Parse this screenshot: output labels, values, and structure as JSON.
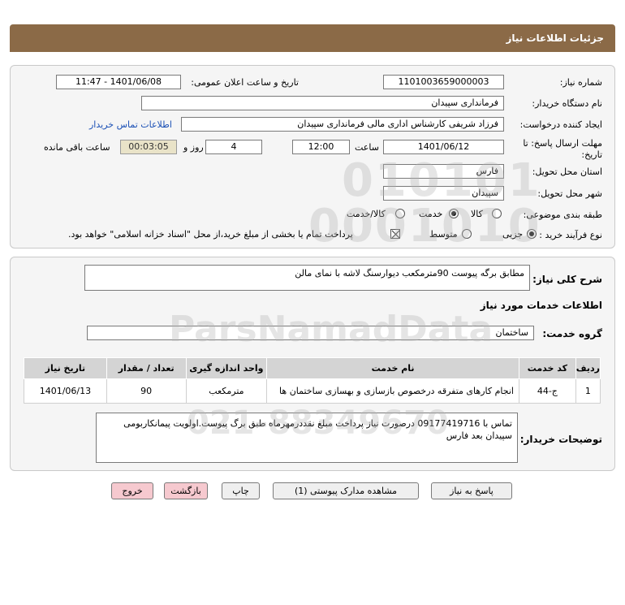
{
  "header": {
    "title": "جزئیات اطلاعات نیاز"
  },
  "form": {
    "need_number": {
      "label": "شماره نیاز:",
      "value": "1101003659000003"
    },
    "announce_datetime": {
      "label": "تاریخ و ساعت اعلان عمومی:",
      "value": "1401/06/08 - 11:47"
    },
    "buyer_org": {
      "label": "نام دستگاه خریدار:",
      "value": "فرمانداری سپیدان"
    },
    "creator": {
      "label": "ایجاد کننده درخواست:",
      "value": "فرزاد شریفی کارشناس اداری مالی فرمانداری سپیدان",
      "contact_link": "اطلاعات تماس خریدار"
    },
    "deadline": {
      "label_line1": "مهلت ارسال پاسخ: تا",
      "label_line2": "تاریخ:",
      "date": "1401/06/12",
      "time_label": "ساعت",
      "time": "12:00",
      "days": "4",
      "days_label": "روز و",
      "remaining": "00:03:05",
      "remaining_label": "ساعت باقی مانده"
    },
    "province": {
      "label": "استان محل تحویل:",
      "value": "فارس"
    },
    "city": {
      "label": "شهر محل تحویل:",
      "value": "سپیدان"
    },
    "category": {
      "label": "طبقه بندی موضوعی:",
      "options": [
        "کالا",
        "خدمت",
        "کالا/خدمت"
      ],
      "selected": "خدمت"
    },
    "purchase_type": {
      "label": "نوع فرآیند خرید :",
      "options": [
        "جزیی",
        "متوسط"
      ],
      "selected": "جزیی",
      "treasury_note": "پرداخت تمام یا بخشی از مبلغ خرید،از محل \"اسناد خزانه اسلامی\" خواهد بود."
    }
  },
  "description": {
    "label": "شرح کلی نیاز:",
    "value": "مطابق برگه پیوست 90مترمکعب دیوارسنگ لاشه با نمای مالن"
  },
  "services_info": {
    "title": "اطلاعات خدمات مورد نیاز"
  },
  "service_group": {
    "label": "گروه خدمت:",
    "value": "ساختمان"
  },
  "table": {
    "headers": [
      "ردیف",
      "کد خدمت",
      "نام خدمت",
      "واحد اندازه گیری",
      "تعداد / مقدار",
      "تاریخ نیاز"
    ],
    "rows": [
      [
        "1",
        "ج-44",
        "انجام کارهای متفرقه درخصوص بازسازی و بهسازی ساختمان ها",
        "مترمکعب",
        "90",
        "1401/06/13"
      ]
    ]
  },
  "buyer_notes": {
    "label": "توضیحات خریدار:",
    "value": "تماس با 09177419716 درصورت نیاز پرداخت مبلغ نقددرمهرماه طبق برگ پیوست.اولویت پیمانکاربومی سپیدان بعد فارس"
  },
  "buttons": {
    "reply": "پاسخ به نیاز",
    "view_attachments": "مشاهده مدارک پیوستی (1)",
    "print": "چاپ",
    "back": "بازگشت",
    "exit": "خروج"
  },
  "watermark": {
    "brand": "ParsNamadData",
    "phone": "021-88349670"
  },
  "colors": {
    "header_bar": "#8b6a47",
    "link": "#1a4fb5",
    "table_header": "#d4d4d4",
    "pink_button": "#f6c9cf",
    "timer_bg": "#e9e3c8"
  }
}
